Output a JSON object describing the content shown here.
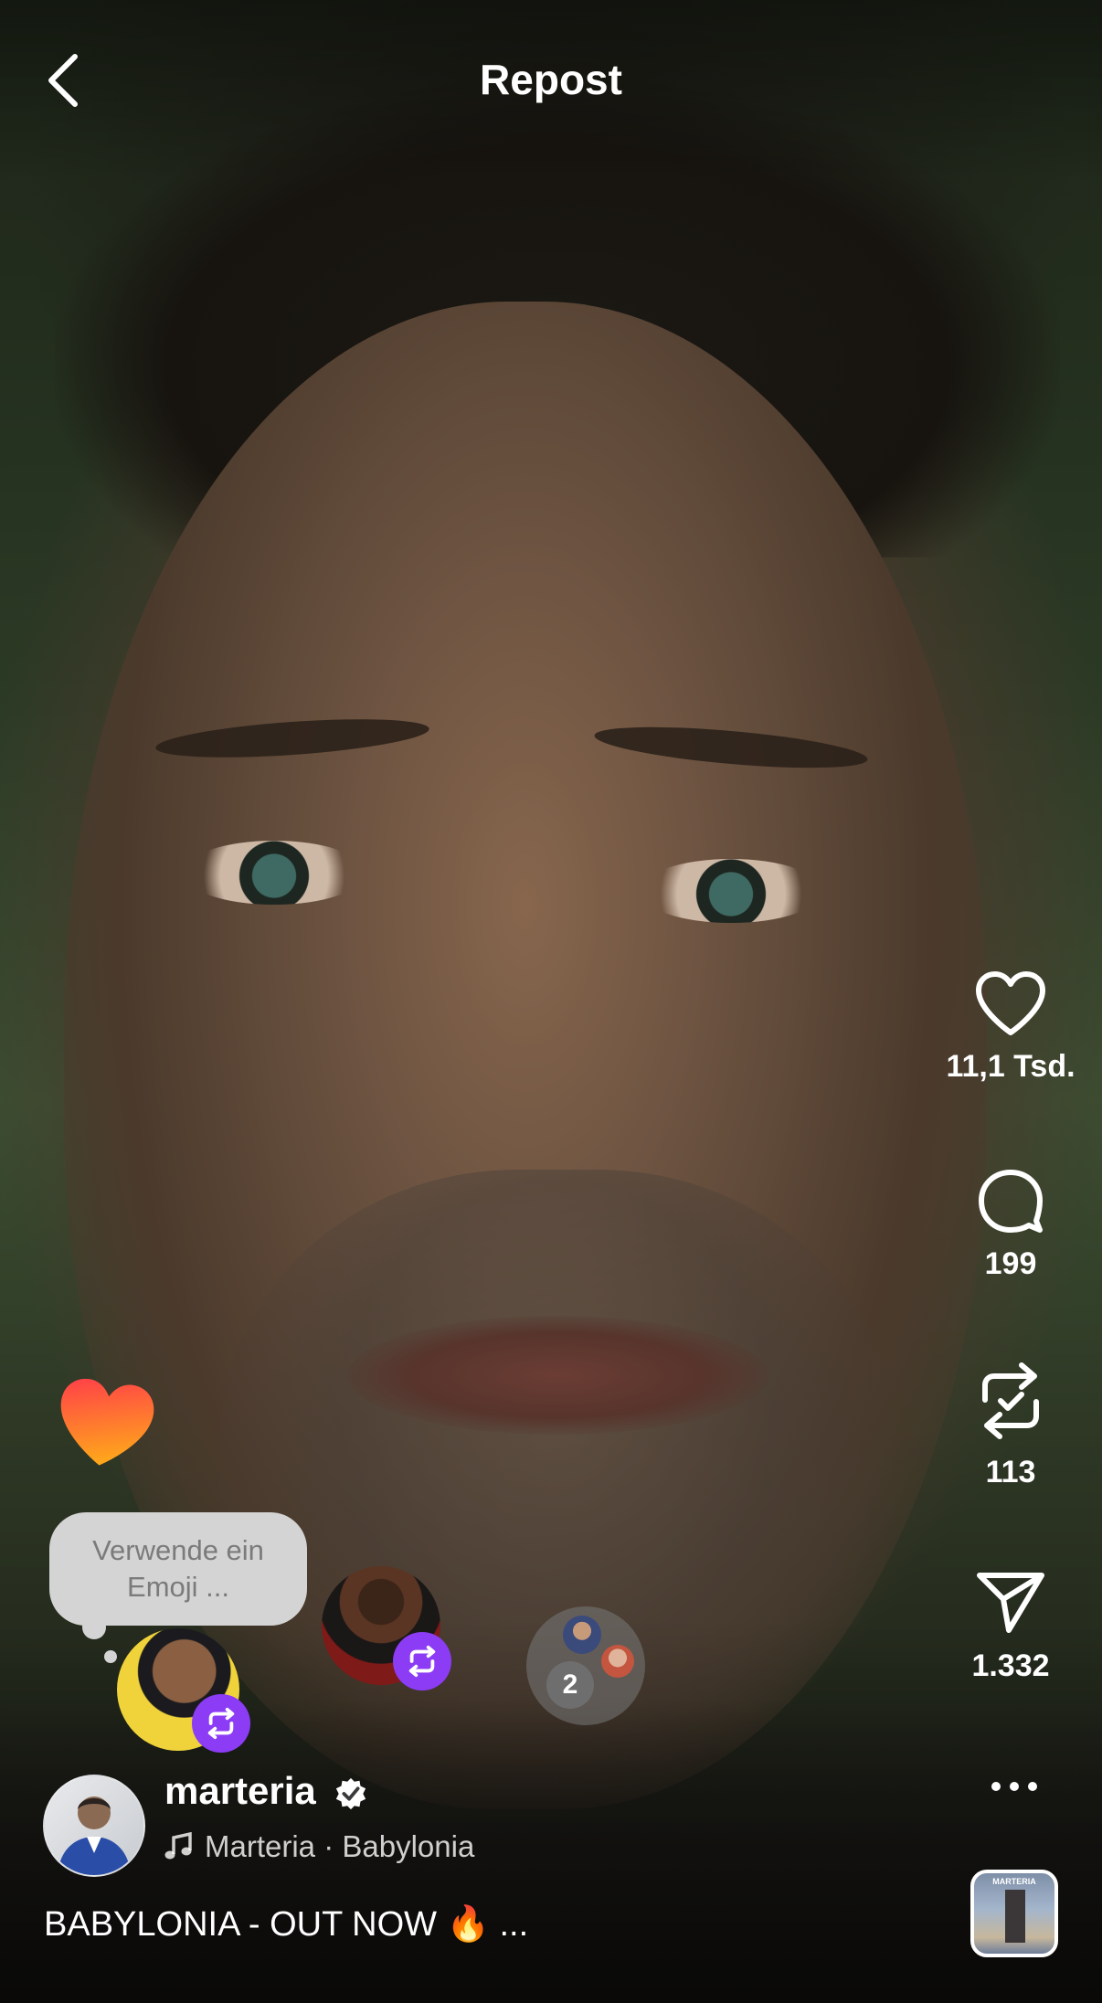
{
  "header": {
    "title": "Repost"
  },
  "actions": {
    "likes": "11,1 Tsd.",
    "comments": "199",
    "reposts": "113",
    "shares": "1.332"
  },
  "emoji_prompt": "Verwende ein Emoji ...",
  "reposters": {
    "group_count": "2"
  },
  "post": {
    "username": "marteria",
    "music": "Marteria · Babylonia",
    "caption": "BABYLONIA - OUT NOW 🔥  ...",
    "album_label": "MARTERIA"
  },
  "colors": {
    "repost_badge": "#8c3cf5",
    "heart_gradient_top": "#ff3d4a",
    "heart_gradient_bottom": "#ffa41c"
  }
}
